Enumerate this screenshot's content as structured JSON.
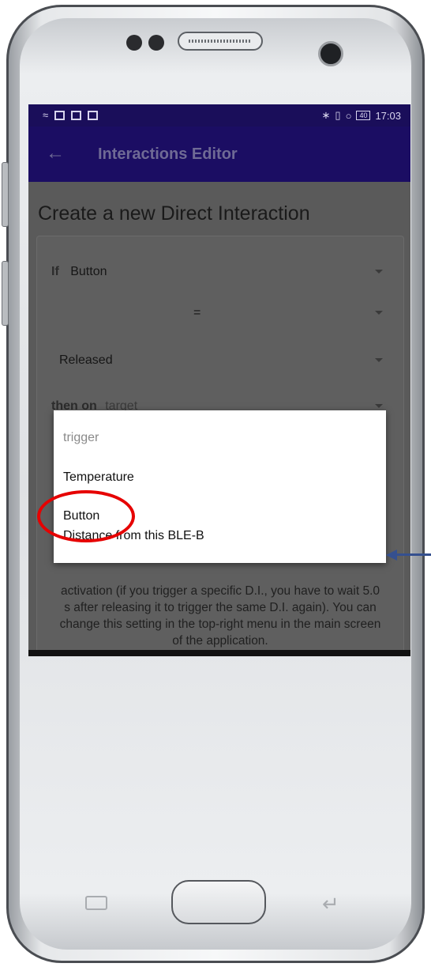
{
  "status_bar": {
    "time": "17:03",
    "battery": "40"
  },
  "app_bar": {
    "back_icon": "arrow-left-icon",
    "title": "Interactions Editor"
  },
  "page_title": "Create a new Direct Interaction",
  "form": {
    "if_label": "If",
    "trigger_value": "Button",
    "operator_value": "=",
    "state_value": "Released",
    "then_label": "then on",
    "target_placeholder": "target",
    "note": "activation (if you trigger a specific D.I., you have to wait 5.0 s after releasing it to trigger the same D.I. again). You can change this setting in the top-right menu in the main screen of the application."
  },
  "dropdown": {
    "header": "trigger",
    "options": [
      "Temperature",
      "Button",
      "Distance from this BLE-B"
    ],
    "highlighted": "Button"
  },
  "colors": {
    "app_bar": "#1b0d63",
    "annotation_circle": "#e60000",
    "annotation_arrow": "#35508f"
  }
}
